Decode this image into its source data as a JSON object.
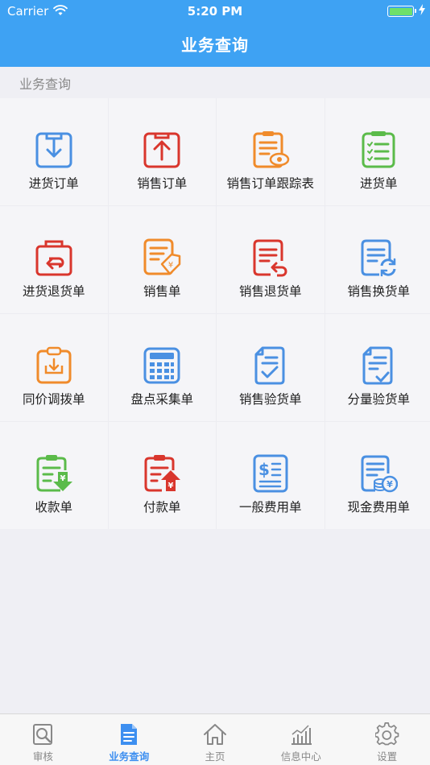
{
  "status_bar": {
    "carrier": "Carrier",
    "time": "5:20 PM"
  },
  "nav": {
    "title": "业务查询"
  },
  "section": {
    "title": "业务查询"
  },
  "grid": {
    "items": [
      {
        "label": "进货订单",
        "icon": "inbox-download-icon"
      },
      {
        "label": "销售订单",
        "icon": "upload-order-icon"
      },
      {
        "label": "销售订单跟踪表",
        "icon": "clipboard-eye-icon"
      },
      {
        "label": "进货单",
        "icon": "checklist-icon"
      },
      {
        "label": "进货退货单",
        "icon": "return-bag-icon"
      },
      {
        "label": "销售单",
        "icon": "document-tag-icon"
      },
      {
        "label": "销售退货单",
        "icon": "document-return-icon"
      },
      {
        "label": "销售换货单",
        "icon": "document-exchange-icon"
      },
      {
        "label": "同价调拨单",
        "icon": "clipboard-transfer-icon"
      },
      {
        "label": "盘点采集单",
        "icon": "calculator-icon"
      },
      {
        "label": "销售验货单",
        "icon": "document-check-icon"
      },
      {
        "label": "分量验货单",
        "icon": "document-list-check-icon"
      },
      {
        "label": "收款单",
        "icon": "receipt-in-icon"
      },
      {
        "label": "付款单",
        "icon": "receipt-out-icon"
      },
      {
        "label": "一般费用单",
        "icon": "dollar-document-icon"
      },
      {
        "label": "现金费用单",
        "icon": "cash-coins-icon"
      }
    ]
  },
  "tabbar": {
    "tabs": [
      {
        "label": "审核",
        "icon": "review-icon"
      },
      {
        "label": "业务查询",
        "icon": "document-icon",
        "active": true
      },
      {
        "label": "主页",
        "icon": "home-icon"
      },
      {
        "label": "信息中心",
        "icon": "chart-icon"
      },
      {
        "label": "设置",
        "icon": "gear-icon"
      }
    ]
  },
  "colors": {
    "header": "#3ea2f3",
    "blue": "#4a90e2",
    "red": "#d9362d",
    "orange": "#f08b2b",
    "green": "#5bbb4a",
    "tab_active": "#3d8ff0"
  }
}
